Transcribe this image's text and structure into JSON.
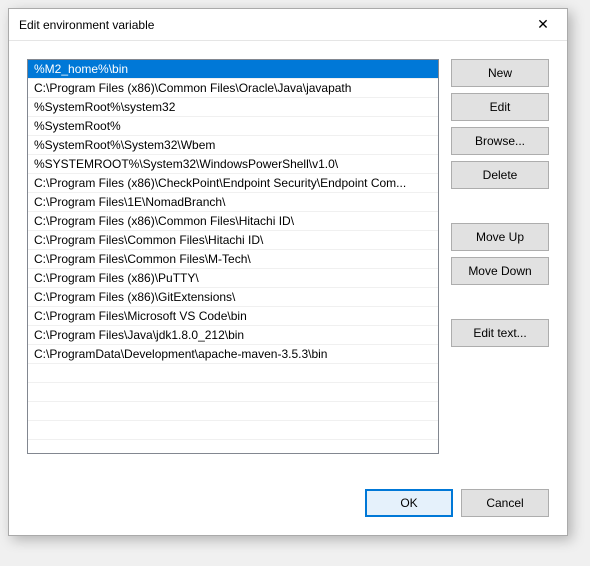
{
  "window": {
    "title": "Edit environment variable"
  },
  "list": {
    "items": [
      "%M2_home%\\bin",
      "C:\\Program Files (x86)\\Common Files\\Oracle\\Java\\javapath",
      "%SystemRoot%\\system32",
      "%SystemRoot%",
      "%SystemRoot%\\System32\\Wbem",
      "%SYSTEMROOT%\\System32\\WindowsPowerShell\\v1.0\\",
      "C:\\Program Files (x86)\\CheckPoint\\Endpoint Security\\Endpoint Com...",
      "C:\\Program Files\\1E\\NomadBranch\\",
      "C:\\Program Files (x86)\\Common Files\\Hitachi ID\\",
      "C:\\Program Files\\Common Files\\Hitachi ID\\",
      "C:\\Program Files\\Common Files\\M-Tech\\",
      "C:\\Program Files (x86)\\PuTTY\\",
      "C:\\Program Files (x86)\\GitExtensions\\",
      "C:\\Program Files\\Microsoft VS Code\\bin",
      "C:\\Program Files\\Java\\jdk1.8.0_212\\bin",
      "C:\\ProgramData\\Development\\apache-maven-3.5.3\\bin"
    ],
    "selected_index": 0
  },
  "buttons": {
    "new": "New",
    "edit": "Edit",
    "browse": "Browse...",
    "delete": "Delete",
    "move_up": "Move Up",
    "move_down": "Move Down",
    "edit_text": "Edit text...",
    "ok": "OK",
    "cancel": "Cancel"
  }
}
